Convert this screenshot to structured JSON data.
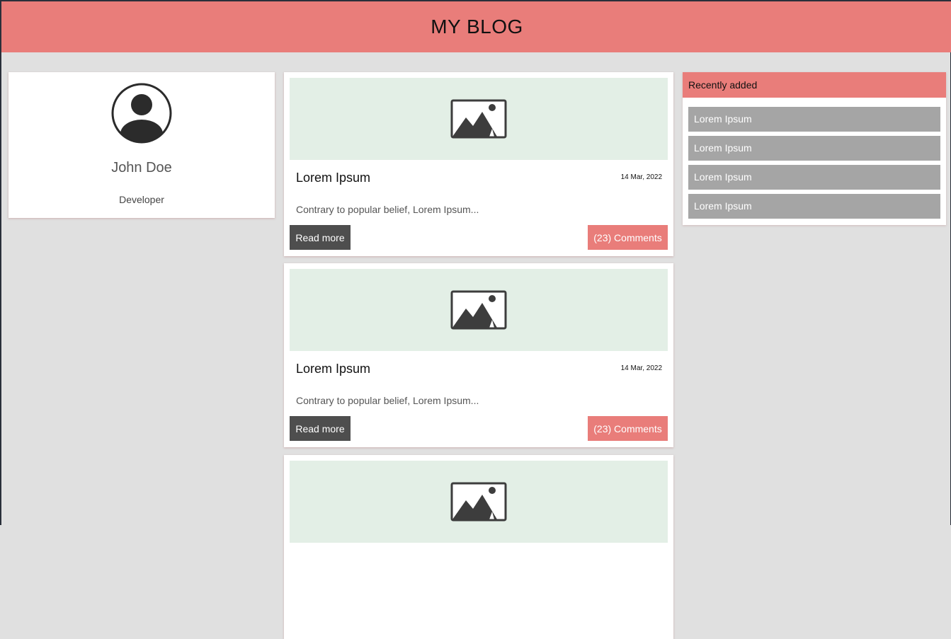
{
  "header": {
    "title": "MY BLOG"
  },
  "profile": {
    "name": "John Doe",
    "role": "Developer"
  },
  "posts": [
    {
      "title": "Lorem Ipsum",
      "date": "14 Mar, 2022",
      "excerpt": "Contrary to popular belief, Lorem Ipsum...",
      "read_more": "Read more",
      "comments": "(23) Comments"
    },
    {
      "title": "Lorem Ipsum",
      "date": "14 Mar, 2022",
      "excerpt": "Contrary to popular belief, Lorem Ipsum...",
      "read_more": "Read more",
      "comments": "(23) Comments"
    },
    {
      "title": "",
      "date": "",
      "excerpt": "",
      "read_more": "",
      "comments": ""
    }
  ],
  "recent": {
    "title": "Recently added",
    "items": [
      "Lorem Ipsum",
      "Lorem Ipsum",
      "Lorem Ipsum",
      "Lorem Ipsum"
    ]
  },
  "icons": {
    "avatar": "user-avatar-icon",
    "post_image": "image-placeholder-icon"
  },
  "colors": {
    "accent": "#e97d7a",
    "background": "#e0e0e0",
    "thumbnail": "#e3efe6",
    "button_dark": "#4e4e4e",
    "list_item": "#a5a5a5"
  }
}
